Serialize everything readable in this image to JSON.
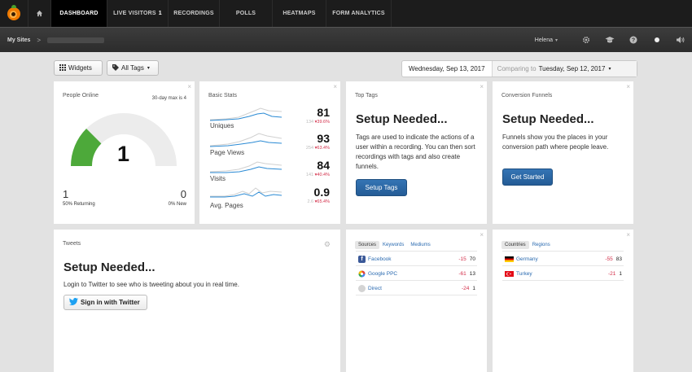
{
  "nav": {
    "tabs": [
      {
        "label": "DASHBOARD"
      },
      {
        "label": "LIVE VISITORS",
        "badge": "1"
      },
      {
        "label": "RECORDINGS"
      },
      {
        "label": "POLLS"
      },
      {
        "label": "HEATMAPS"
      },
      {
        "label": "FORM ANALYTICS"
      }
    ]
  },
  "subbar": {
    "my_sites": "My Sites",
    "chevron": ">",
    "user": "Helena"
  },
  "icons": {
    "home": "home-icon",
    "settings": "gear-icon",
    "learn": "graduation-cap-icon",
    "help": "question-icon",
    "status": "dot-icon",
    "sound": "speaker-icon"
  },
  "toolbar": {
    "widgets_label": "Widgets",
    "tags_label": "All Tags",
    "date": "Wednesday, Sep 13, 2017",
    "comparing_prefix": "Comparing to",
    "comparing_date": "Tuesday, Sep 12, 2017"
  },
  "people_online": {
    "title": "People Online",
    "max_note": "30-day max is 4",
    "current": "1",
    "gauge_fraction": 0.25,
    "returning_count": "1",
    "returning_label": "50% Returning",
    "new_count": "0",
    "new_label": "0% New"
  },
  "basic_stats": {
    "title": "Basic Stats",
    "rows": [
      {
        "label": "Uniques",
        "value": "81",
        "prev": "134",
        "delta": "39.6%"
      },
      {
        "label": "Page Views",
        "value": "93",
        "prev": "254",
        "delta": "63.4%"
      },
      {
        "label": "Visits",
        "value": "84",
        "prev": "141",
        "delta": "40.4%"
      },
      {
        "label": "Avg. Pages",
        "value": "0.9",
        "prev": "2.6",
        "delta": "65.4%"
      }
    ]
  },
  "top_tags": {
    "title": "Top Tags",
    "heading": "Setup Needed...",
    "text": "Tags are used to indicate the actions of a user within a recording. You can then sort recordings with tags and also create funnels.",
    "button": "Setup Tags"
  },
  "conversion_funnels": {
    "title": "Conversion Funnels",
    "heading": "Setup Needed...",
    "text": "Funnels show you the places in your conversion path where people leave.",
    "button": "Get Started"
  },
  "tweets": {
    "title": "Tweets",
    "heading": "Setup Needed...",
    "text": "Login to Twitter to see who is tweeting about you in real time.",
    "button": "Sign in with Twitter"
  },
  "sources": {
    "tabs": [
      "Sources",
      "Keywords",
      "Mediums"
    ],
    "rows": [
      {
        "name": "Facebook",
        "delta": "-15",
        "count": "70",
        "icon": "facebook-icon"
      },
      {
        "name": "Google PPC",
        "delta": "-61",
        "count": "13",
        "icon": "google-icon"
      },
      {
        "name": "Direct",
        "delta": "-24",
        "count": "1",
        "icon": "direct-icon"
      }
    ]
  },
  "countries": {
    "tabs": [
      "Countries",
      "Regions"
    ],
    "rows": [
      {
        "name": "Germany",
        "delta": "-55",
        "count": "83",
        "icon": "germany-flag-icon"
      },
      {
        "name": "Turkey",
        "delta": "-21",
        "count": "1",
        "icon": "turkey-flag-icon"
      }
    ]
  },
  "close_glyph": "×"
}
